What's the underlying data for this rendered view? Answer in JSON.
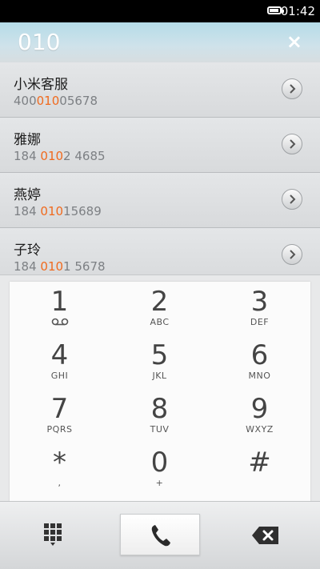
{
  "status": {
    "time": "01:42",
    "battery_level": 0.8
  },
  "search": {
    "query": "010",
    "clear_label": "×"
  },
  "results": [
    {
      "name": "小米客服",
      "pre": "400",
      "match": "010",
      "post": "05678"
    },
    {
      "name": "雅娜",
      "pre": "184 ",
      "match": "010",
      "post": "2 4685"
    },
    {
      "name": "燕婷",
      "pre": "184 ",
      "match": "010",
      "post": "15689"
    },
    {
      "name": "子玲",
      "pre": "184 ",
      "match": "010",
      "post": "1 5678"
    }
  ],
  "keys": [
    {
      "digit": "1",
      "letters": ""
    },
    {
      "digit": "2",
      "letters": "ABC"
    },
    {
      "digit": "3",
      "letters": "DEF"
    },
    {
      "digit": "4",
      "letters": "GHI"
    },
    {
      "digit": "5",
      "letters": "JKL"
    },
    {
      "digit": "6",
      "letters": "MNO"
    },
    {
      "digit": "7",
      "letters": "PQRS"
    },
    {
      "digit": "8",
      "letters": "TUV"
    },
    {
      "digit": "9",
      "letters": "WXYZ"
    },
    {
      "digit": "*",
      "letters": ","
    },
    {
      "digit": "0",
      "letters": "+"
    },
    {
      "digit": "#",
      "letters": ""
    }
  ],
  "icons": {
    "detail": "chevron-right-icon",
    "voicemail": "voicemail-icon",
    "dialpad": "dialpad-icon",
    "call": "phone-icon",
    "backspace": "backspace-icon"
  },
  "colors": {
    "highlight": "#f06a1e",
    "header": "#b5dce8"
  }
}
